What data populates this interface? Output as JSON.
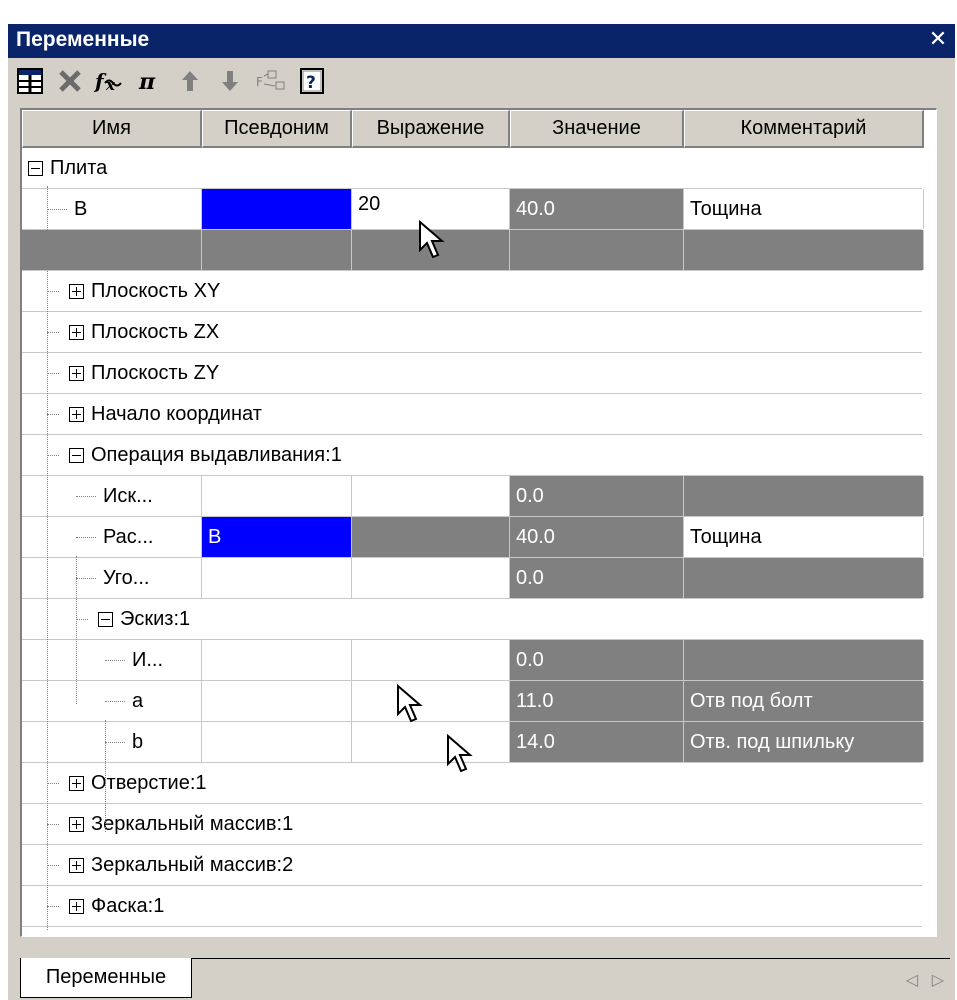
{
  "window": {
    "title": "Переменные",
    "close_glyph": "✕"
  },
  "toolbar": {
    "icons": [
      "variables-table-icon",
      "delete-icon",
      "function-icon",
      "pi-icon",
      "move-up-icon",
      "move-down-icon",
      "fit-icon",
      "help-icon"
    ]
  },
  "columns": [
    "Имя",
    "Псевдоним",
    "Выражение",
    "Значение",
    "Комментарий"
  ],
  "rows": [
    {
      "label": "Плита",
      "expander": "minus"
    },
    {
      "name": "B",
      "alias": "",
      "expression": "20",
      "value": "40.0",
      "comment": "Тощина"
    },
    {
      "name": "",
      "alias": "",
      "expression": "",
      "value": "",
      "comment": ""
    },
    {
      "label": "Плоскость XY",
      "expander": "plus"
    },
    {
      "label": "Плоскость ZX",
      "expander": "plus"
    },
    {
      "label": "Плоскость ZY",
      "expander": "plus"
    },
    {
      "label": "Начало координат",
      "expander": "plus"
    },
    {
      "label": "Операция выдавливания:1",
      "expander": "minus"
    },
    {
      "name": "Иск...",
      "alias": "",
      "expression": "",
      "value": "0.0",
      "comment": ""
    },
    {
      "name": "Рас...",
      "alias": "B",
      "expression": "",
      "value": "40.0",
      "comment": "Тощина"
    },
    {
      "name": "Уго...",
      "alias": "",
      "expression": "",
      "value": "0.0",
      "comment": ""
    },
    {
      "label": "Эскиз:1",
      "expander": "minus"
    },
    {
      "name": "И...",
      "alias": "",
      "expression": "",
      "value": "0.0",
      "comment": ""
    },
    {
      "name": "a",
      "alias": "",
      "expression": "",
      "value": "11.0",
      "comment": "Отв под болт"
    },
    {
      "name": "b",
      "alias": "",
      "expression": "",
      "value": "14.0",
      "comment": "Отв. под шпильку"
    },
    {
      "label": "Отверстие:1",
      "expander": "plus"
    },
    {
      "label": "Зеркальный массив:1",
      "expander": "plus"
    },
    {
      "label": "Зеркальный массив:2",
      "expander": "plus"
    },
    {
      "label": "Фаска:1",
      "expander": "plus"
    }
  ],
  "tabs": {
    "active": "Переменные",
    "scroll_left": "◁",
    "scroll_right": "▷"
  },
  "colors": {
    "title_bar": "#0a246a",
    "highlight": "#0000ff",
    "readonly_cell": "#808080",
    "panel": "#d4d0c8"
  }
}
